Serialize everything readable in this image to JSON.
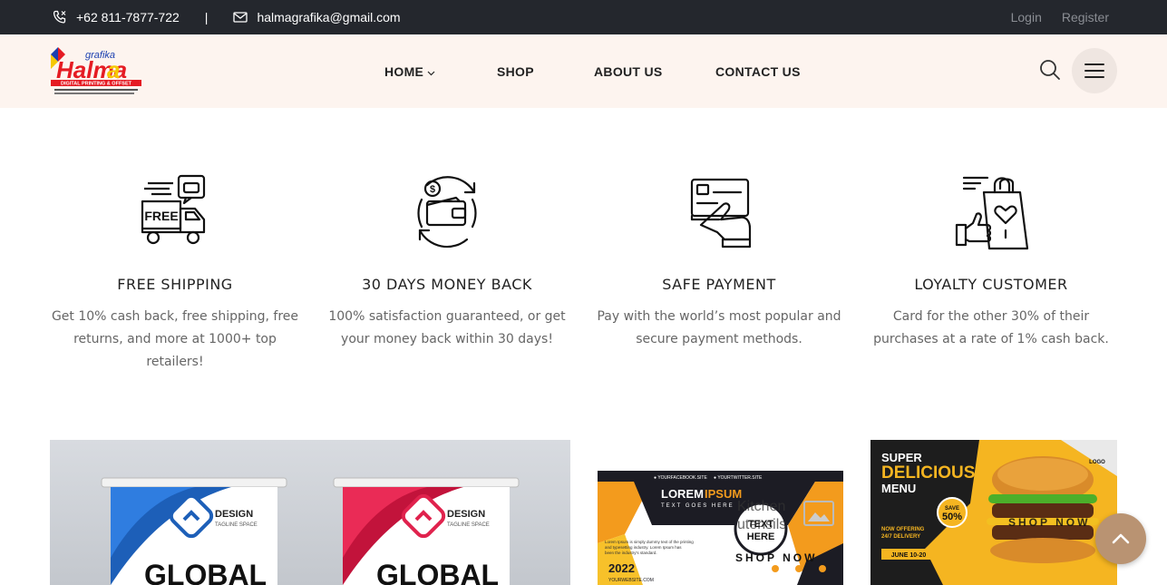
{
  "topbar": {
    "phone": "+62 811-7877-722",
    "separator": "|",
    "email": "halmagrafika@gmail.com",
    "login": "Login",
    "register": "Register"
  },
  "header": {
    "logo_top": "grafika",
    "logo_main": "Halma",
    "logo_sub": "DIGITAL PRINTING & OFFSET",
    "nav": [
      "HOME",
      "SHOP",
      "ABOUT US",
      "CONTACT US"
    ]
  },
  "features": [
    {
      "icon": "free-shipping-truck-icon",
      "title": "FREE SHIPPING",
      "line1": "Get 10% cash back, free shipping, free",
      "line2": "returns, and more at 1000+ top retailers!"
    },
    {
      "icon": "money-back-wallet-icon",
      "title": "30 DAYS MONEY BACK",
      "line1": "100% satisfaction guaranteed, or get",
      "line2": "your money back within 30 days!"
    },
    {
      "icon": "card-payment-icon",
      "title": "SAFE PAYMENT",
      "line1": "Pay with the world’s most popular and",
      "line2": "secure payment methods."
    },
    {
      "icon": "loyalty-bag-icon",
      "title": "LOYALTY CUSTOMER",
      "line1": "Card for the other 30% of their",
      "line2": "purchases at a rate of 1% cash back."
    }
  ],
  "banners": {
    "roll_up": {
      "design_label": "DESIGN",
      "tagline": "TAGLINE SPACE",
      "big_text": "GLOBAL"
    },
    "flyer": {
      "header_left": "YOURFACEBOOK.SITE",
      "header_right": "YOURTWITTER.SITE",
      "title_a": "LOREM",
      "title_b": "IPSUM",
      "subtitle": "TEXT GOES HERE",
      "circle_text_1": "TEXT",
      "circle_text_2": "HERE",
      "body": "Lorem Ipsum is simply dummy text of the printing and typesetting industry. Lorem Ipsum has been the industry's standard.",
      "year": "2022",
      "site": "YOURWEBSITE.COM",
      "overlay_1": "Kitchen",
      "overlay_2": "utensils",
      "shop_now": "SHOP NOW"
    },
    "food": {
      "line1": "SUPER",
      "line2": "DELICIOUS",
      "line3": "MENU",
      "badge_top": "SAVE",
      "badge_value": "50%",
      "offer_1": "NOW OFFERING",
      "offer_2": "24/7 DELIVERY",
      "dates": "JUNE 10-20",
      "logo": "LOGO",
      "shop_now": "SHOP NOW"
    }
  },
  "colors": {
    "topbar_bg": "#24272d",
    "header_bg": "#fdf4ef",
    "accent": "#b99372"
  }
}
